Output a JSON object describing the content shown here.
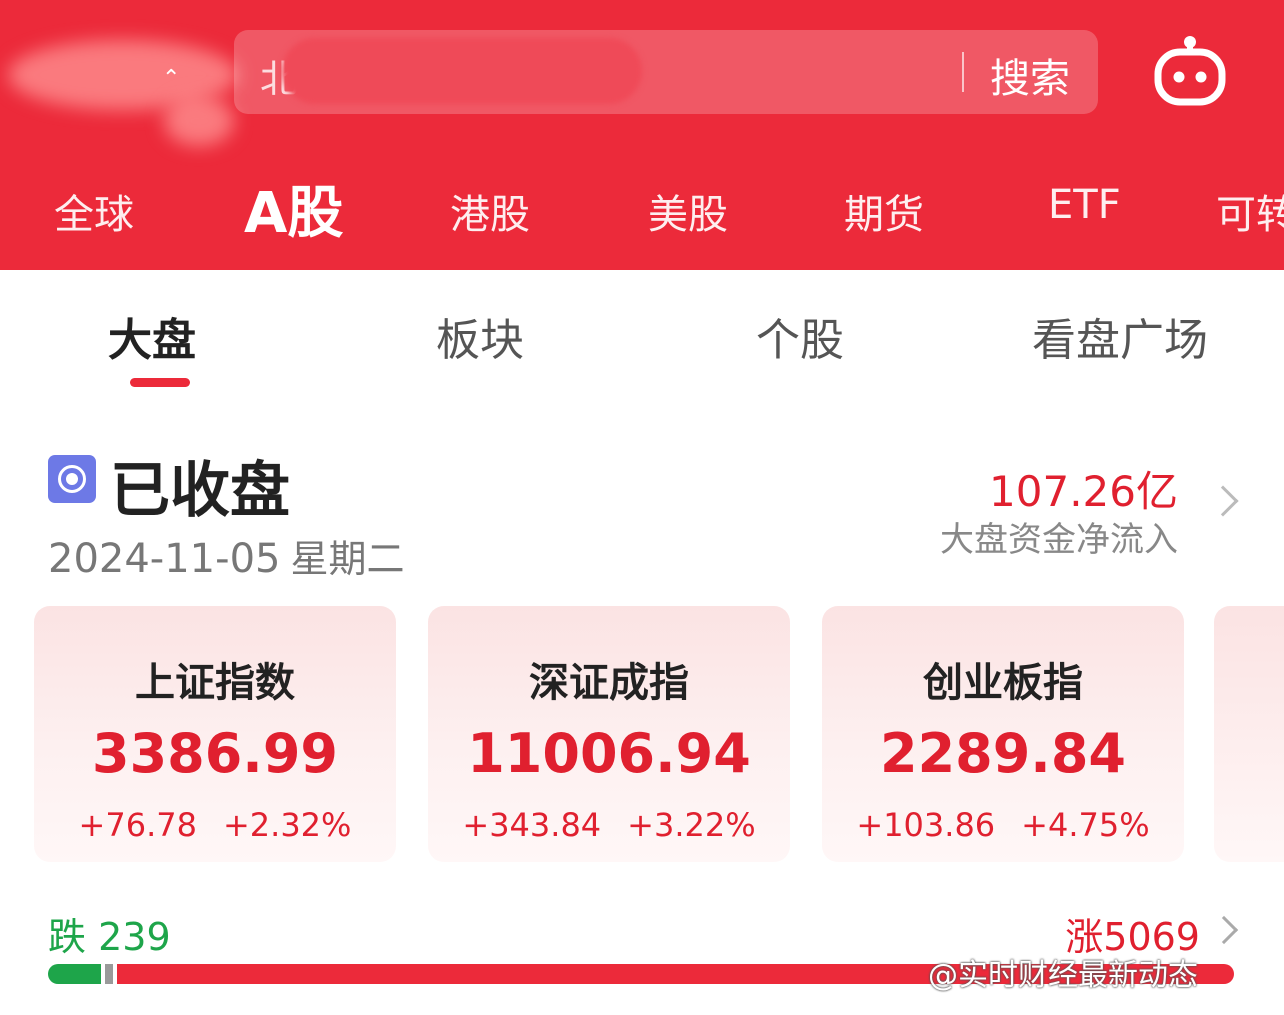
{
  "header": {
    "search": {
      "placeholder": "北",
      "button": "搜索"
    },
    "robot_icon": "robot-assistant-icon",
    "market_tabs": [
      {
        "label": "全球",
        "active": false
      },
      {
        "label": "A股",
        "active": true
      },
      {
        "label": "港股",
        "active": false
      },
      {
        "label": "美股",
        "active": false
      },
      {
        "label": "期货",
        "active": false
      },
      {
        "label": "ETF",
        "active": false
      },
      {
        "label": "可转",
        "active": false
      }
    ]
  },
  "sub_tabs": [
    {
      "label": "大盘",
      "active": true
    },
    {
      "label": "板块",
      "active": false
    },
    {
      "label": "个股",
      "active": false
    },
    {
      "label": "看盘广场",
      "active": false
    }
  ],
  "status": {
    "label": "已收盘",
    "date": "2024-11-05",
    "weekday": "星期二",
    "fund_flow_value": "107.26亿",
    "fund_flow_label": "大盘资金净流入"
  },
  "indices": [
    {
      "name": "上证指数",
      "value": "3386.99",
      "change": "+76.78",
      "percent": "+2.32%"
    },
    {
      "name": "深证成指",
      "value": "11006.94",
      "change": "+343.84",
      "percent": "+3.22%"
    },
    {
      "name": "创业板指",
      "value": "2289.84",
      "change": "+103.86",
      "percent": "+4.75%"
    }
  ],
  "breadth": {
    "fall_label": "跌",
    "fall_count": "239",
    "rise_label": "涨",
    "rise_count": "5069",
    "fall": 239,
    "rise": 5069
  },
  "watermark": "@实时财经最新动态",
  "colors": {
    "brand_red": "#ec2a3a",
    "rise_red": "#e0202f",
    "fall_green": "#1ea54a",
    "status_icon": "#6d79e6"
  }
}
